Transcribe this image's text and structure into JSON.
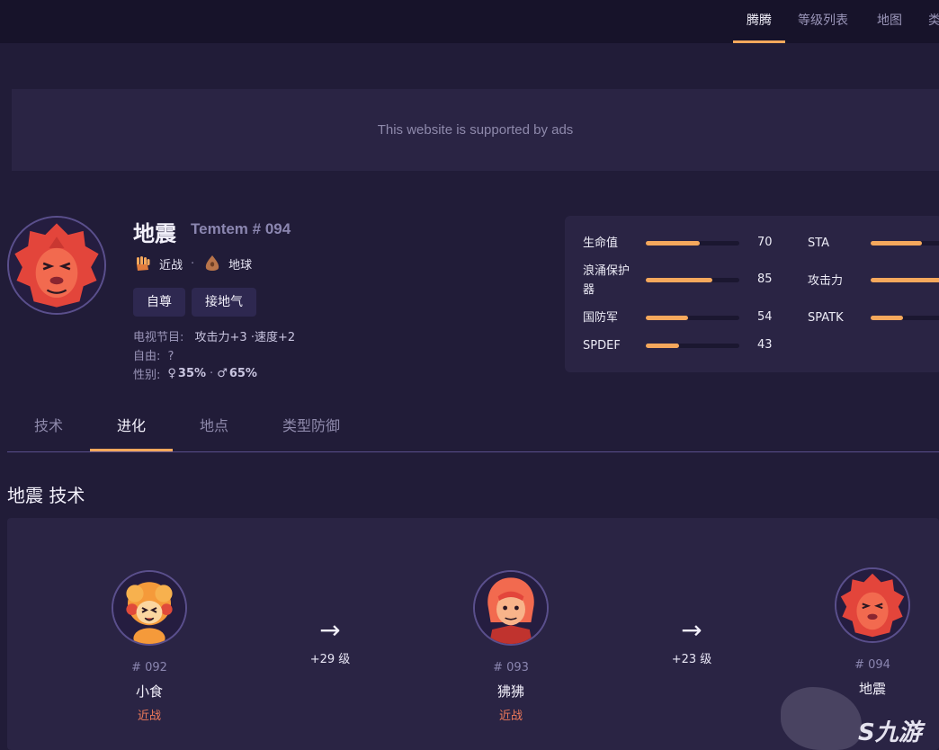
{
  "nav": {
    "tabs": [
      {
        "label": "腾腾"
      },
      {
        "label": "等级列表"
      },
      {
        "label": "地图"
      },
      {
        "label": "类"
      }
    ]
  },
  "ad": {
    "text": "This website is supported by ads"
  },
  "temtem": {
    "name": "地震",
    "number_label": "Temtem # 094",
    "types": [
      {
        "label": "近战",
        "icon": "fist-icon"
      },
      {
        "label": "地球",
        "icon": "earth-icon"
      }
    ],
    "type_separator": "·",
    "traits": [
      "自尊",
      "接地气"
    ],
    "tv_yield": {
      "label": "电视节目:",
      "value": "攻击力+3 ·速度+2"
    },
    "free": {
      "label": "自由:",
      "value": "?"
    },
    "gender": {
      "label": "性别:",
      "female": "35%",
      "male": "65%",
      "sep": "·"
    }
  },
  "stats": [
    {
      "label": "生命值",
      "value": "70",
      "max": 127
    },
    {
      "label": "STA",
      "value": "",
      "max": 127
    },
    {
      "label": "浪涌保护器",
      "value": "85",
      "max": 127
    },
    {
      "label": "攻击力",
      "value": "",
      "max": 127
    },
    {
      "label": "国防军",
      "value": "54",
      "max": 127
    },
    {
      "label": "SPATK",
      "value": "",
      "max": 127
    },
    {
      "label": "SPDEF",
      "value": "43",
      "max": 127
    }
  ],
  "stat_fill_fractions": {
    "hp": 0.58,
    "sta": 0.55,
    "surge": 0.71,
    "atk": 0.78,
    "def": 0.45,
    "spatk": 0.35,
    "spdef": 0.36
  },
  "tabs": [
    {
      "label": "技术"
    },
    {
      "label": "进化"
    },
    {
      "label": "地点"
    },
    {
      "label": "类型防御"
    }
  ],
  "section": {
    "title": "地震 技术"
  },
  "evolution": {
    "stages": [
      {
        "number": "# 092",
        "name": "小食",
        "type": "近战"
      },
      {
        "number": "# 093",
        "name": "狒狒",
        "type": "近战"
      },
      {
        "number": "# 094",
        "name": "地震",
        "type": ""
      }
    ],
    "arrows": [
      {
        "symbol": "→",
        "level": "+29 级"
      },
      {
        "symbol": "→",
        "level": "+23 级"
      }
    ]
  },
  "watermark": {
    "text": "九游"
  },
  "colors": {
    "accent": "#f5a85c",
    "background": "#211c38",
    "card": "#2a2444",
    "melee": "#ef7a5a"
  }
}
